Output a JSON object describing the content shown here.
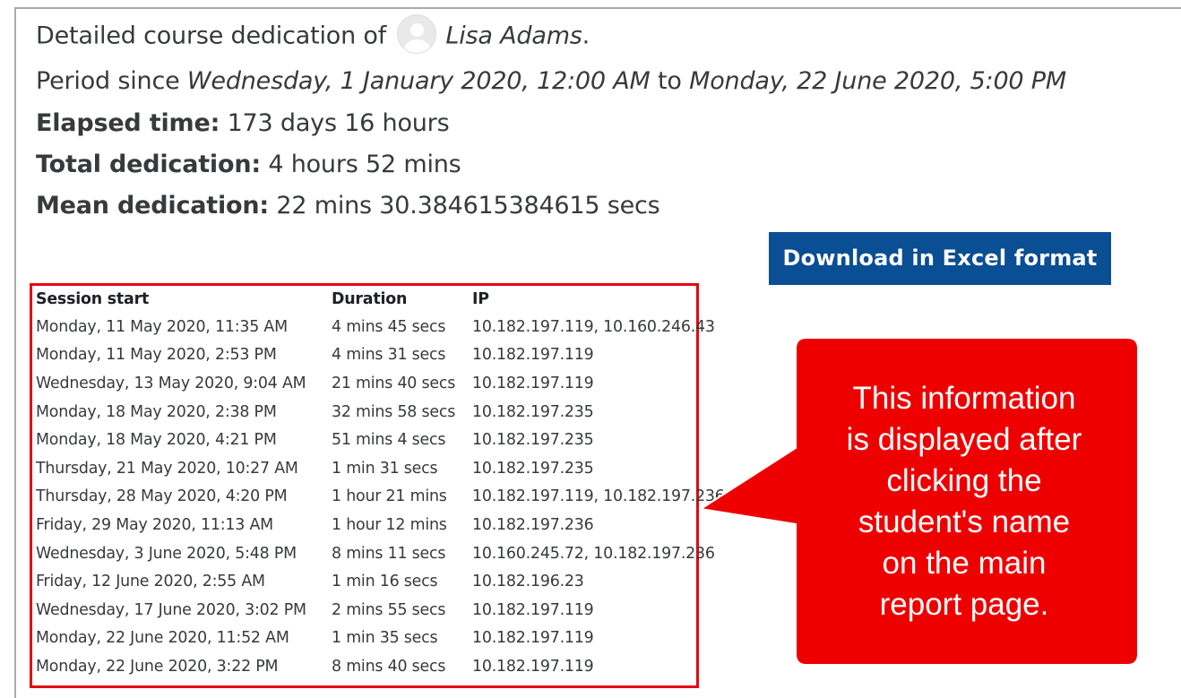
{
  "header": {
    "title_prefix": "Detailed course dedication of",
    "user_name": "Lisa Adams",
    "title_suffix": "."
  },
  "period": {
    "prefix": "Period since",
    "start": "Wednesday, 1 January 2020, 12:00 AM",
    "connector": "to",
    "end": "Monday, 22 June 2020, 5:00 PM"
  },
  "stats": {
    "elapsed_label": "Elapsed time:",
    "elapsed_value": "173 days 16 hours",
    "total_label": "Total dedication:",
    "total_value": "4 hours 52 mins",
    "mean_label": "Mean dedication:",
    "mean_value": "22 mins 30.384615384615 secs"
  },
  "download_button": {
    "label": "Download in Excel format"
  },
  "table": {
    "headers": [
      "Session start",
      "Duration",
      "IP"
    ],
    "rows": [
      {
        "start": "Monday, 11 May 2020, 11:35 AM",
        "duration": "4 mins 45 secs",
        "ip": "10.182.197.119, 10.160.246.43"
      },
      {
        "start": "Monday, 11 May 2020, 2:53 PM",
        "duration": "4 mins 31 secs",
        "ip": "10.182.197.119"
      },
      {
        "start": "Wednesday, 13 May 2020, 9:04 AM",
        "duration": "21 mins 40 secs",
        "ip": "10.182.197.119"
      },
      {
        "start": "Monday, 18 May 2020, 2:38 PM",
        "duration": "32 mins 58 secs",
        "ip": "10.182.197.235"
      },
      {
        "start": "Monday, 18 May 2020, 4:21 PM",
        "duration": "51 mins 4 secs",
        "ip": "10.182.197.235"
      },
      {
        "start": "Thursday, 21 May 2020, 10:27 AM",
        "duration": "1 min 31 secs",
        "ip": "10.182.197.235"
      },
      {
        "start": "Thursday, 28 May 2020, 4:20 PM",
        "duration": "1 hour 21 mins",
        "ip": "10.182.197.119, 10.182.197.236"
      },
      {
        "start": "Friday, 29 May 2020, 11:13 AM",
        "duration": "1 hour 12 mins",
        "ip": "10.182.197.236"
      },
      {
        "start": "Wednesday, 3 June 2020, 5:48 PM",
        "duration": "8 mins 11 secs",
        "ip": "10.160.245.72, 10.182.197.236"
      },
      {
        "start": "Friday, 12 June 2020, 2:55 AM",
        "duration": "1 min 16 secs",
        "ip": "10.182.196.23"
      },
      {
        "start": "Wednesday, 17 June 2020, 3:02 PM",
        "duration": "2 mins 55 secs",
        "ip": "10.182.197.119"
      },
      {
        "start": "Monday, 22 June 2020, 11:52 AM",
        "duration": "1 min 35 secs",
        "ip": "10.182.197.119"
      },
      {
        "start": "Monday, 22 June 2020, 3:22 PM",
        "duration": "8 mins 40 secs",
        "ip": "10.182.197.119"
      }
    ]
  },
  "callout": {
    "lines": [
      "This information",
      "is displayed after",
      "clicking the",
      "student's name",
      "on the main",
      "report page."
    ]
  },
  "colors": {
    "button_bg": "#0a4e94",
    "highlight_red": "#e30613",
    "link_blue": "#1d5aa2"
  }
}
